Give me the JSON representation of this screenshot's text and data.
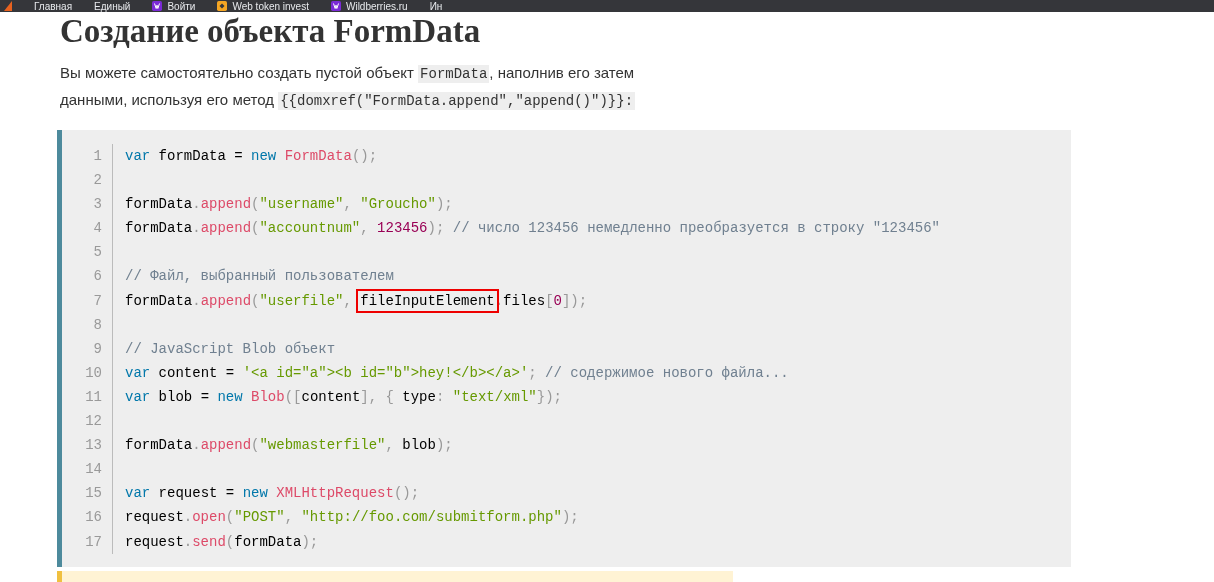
{
  "bookmarks_bar": {
    "items": [
      {
        "label": "Главная",
        "icon": false
      },
      {
        "label": "Единый",
        "icon": false
      },
      {
        "label": "Войти",
        "icon": true
      },
      {
        "label": "Web token invest",
        "icon": true
      },
      {
        "label": "Wildberries.ru",
        "icon": true
      },
      {
        "label": "Ин",
        "icon": false
      }
    ]
  },
  "heading": "Создание объекта FormData",
  "paragraph": [
    {
      "kind": "text",
      "text": "Вы можете самостоятельно создать пустой объект "
    },
    {
      "kind": "code",
      "text": "FormData"
    },
    {
      "kind": "text",
      "text": ", наполнив его затем данными, используя его метод "
    },
    {
      "kind": "code",
      "text": "{{domxref(\"FormData.append\",\"append()\")}}:"
    }
  ],
  "code_block": {
    "lines": [
      {
        "number": "1",
        "tokens": [
          {
            "kind": "keyword",
            "text": "var"
          },
          {
            "kind": "plain",
            "text": " formData = "
          },
          {
            "kind": "keyword",
            "text": "new"
          },
          {
            "kind": "function",
            "text": " FormData"
          },
          {
            "kind": "punctuation",
            "text": "();"
          }
        ]
      },
      {
        "number": "2"
      },
      {
        "number": "3",
        "tokens": [
          {
            "kind": "plain",
            "text": "formData"
          },
          {
            "kind": "punctuation",
            "text": "."
          },
          {
            "kind": "function",
            "text": "append"
          },
          {
            "kind": "punctuation",
            "text": "("
          },
          {
            "kind": "string",
            "text": "\"username\""
          },
          {
            "kind": "punctuation",
            "text": ", "
          },
          {
            "kind": "string",
            "text": "\"Groucho\""
          },
          {
            "kind": "punctuation",
            "text": ");"
          }
        ]
      },
      {
        "number": "4",
        "tokens": [
          {
            "kind": "plain",
            "text": "formData"
          },
          {
            "kind": "punctuation",
            "text": "."
          },
          {
            "kind": "function",
            "text": "append"
          },
          {
            "kind": "punctuation",
            "text": "("
          },
          {
            "kind": "string",
            "text": "\"accountnum\""
          },
          {
            "kind": "punctuation",
            "text": ", "
          },
          {
            "kind": "number",
            "text": "123456"
          },
          {
            "kind": "punctuation",
            "text": ");"
          },
          {
            "kind": "comment",
            "text": " // число 123456 немедленно преобразуется в строку \"123456\""
          }
        ]
      },
      {
        "number": "5"
      },
      {
        "number": "6",
        "tokens": [
          {
            "kind": "comment",
            "text": "// Файл, выбранный пользователем"
          }
        ]
      },
      {
        "number": "7",
        "tokens": [
          {
            "kind": "plain",
            "text": "formData"
          },
          {
            "kind": "punctuation",
            "text": "."
          },
          {
            "kind": "function",
            "text": "append"
          },
          {
            "kind": "punctuation",
            "text": "("
          },
          {
            "kind": "string",
            "text": "\"userfile\""
          },
          {
            "kind": "punctuation",
            "text": ", "
          },
          {
            "kind": "plain",
            "text": "fileInputElement",
            "highlighted": true
          },
          {
            "kind": "punctuation",
            "text": "."
          },
          {
            "kind": "plain",
            "text": "files"
          },
          {
            "kind": "punctuation",
            "text": "["
          },
          {
            "kind": "number",
            "text": "0"
          },
          {
            "kind": "punctuation",
            "text": "]);"
          }
        ]
      },
      {
        "number": "8"
      },
      {
        "number": "9",
        "tokens": [
          {
            "kind": "comment",
            "text": "// JavaScript Blob объект"
          }
        ]
      },
      {
        "number": "10",
        "tokens": [
          {
            "kind": "keyword",
            "text": "var"
          },
          {
            "kind": "plain",
            "text": " content = "
          },
          {
            "kind": "string",
            "text": "'<a id=\"a\"><b id=\"b\">hey!</b></a>'"
          },
          {
            "kind": "punctuation",
            "text": ";"
          },
          {
            "kind": "comment",
            "text": " // содержимое нового файла..."
          }
        ]
      },
      {
        "number": "11",
        "tokens": [
          {
            "kind": "keyword",
            "text": "var"
          },
          {
            "kind": "plain",
            "text": " blob = "
          },
          {
            "kind": "keyword",
            "text": "new"
          },
          {
            "kind": "function",
            "text": " Blob"
          },
          {
            "kind": "punctuation",
            "text": "(["
          },
          {
            "kind": "plain",
            "text": "content"
          },
          {
            "kind": "punctuation",
            "text": "], { "
          },
          {
            "kind": "plain",
            "text": "type"
          },
          {
            "kind": "punctuation",
            "text": ": "
          },
          {
            "kind": "string",
            "text": "\"text/xml\""
          },
          {
            "kind": "punctuation",
            "text": "});"
          }
        ]
      },
      {
        "number": "12"
      },
      {
        "number": "13",
        "tokens": [
          {
            "kind": "plain",
            "text": "formData"
          },
          {
            "kind": "punctuation",
            "text": "."
          },
          {
            "kind": "function",
            "text": "append"
          },
          {
            "kind": "punctuation",
            "text": "("
          },
          {
            "kind": "string",
            "text": "\"webmasterfile\""
          },
          {
            "kind": "punctuation",
            "text": ", "
          },
          {
            "kind": "plain",
            "text": "blob"
          },
          {
            "kind": "punctuation",
            "text": ");"
          }
        ]
      },
      {
        "number": "14"
      },
      {
        "number": "15",
        "tokens": [
          {
            "kind": "keyword",
            "text": "var"
          },
          {
            "kind": "plain",
            "text": " request = "
          },
          {
            "kind": "keyword",
            "text": "new"
          },
          {
            "kind": "function",
            "text": " XMLHttpRequest"
          },
          {
            "kind": "punctuation",
            "text": "();"
          }
        ]
      },
      {
        "number": "16",
        "tokens": [
          {
            "kind": "plain",
            "text": "request"
          },
          {
            "kind": "punctuation",
            "text": "."
          },
          {
            "kind": "function",
            "text": "open"
          },
          {
            "kind": "punctuation",
            "text": "("
          },
          {
            "kind": "string",
            "text": "\"POST\""
          },
          {
            "kind": "punctuation",
            "text": ", "
          },
          {
            "kind": "string",
            "text": "\"http://foo.com/submitform.php\""
          },
          {
            "kind": "punctuation",
            "text": ");"
          }
        ]
      },
      {
        "number": "17",
        "tokens": [
          {
            "kind": "plain",
            "text": "request"
          },
          {
            "kind": "punctuation",
            "text": "."
          },
          {
            "kind": "function",
            "text": "send"
          },
          {
            "kind": "punctuation",
            "text": "("
          },
          {
            "kind": "plain",
            "text": "formData"
          },
          {
            "kind": "punctuation",
            "text": ");"
          }
        ]
      }
    ]
  }
}
